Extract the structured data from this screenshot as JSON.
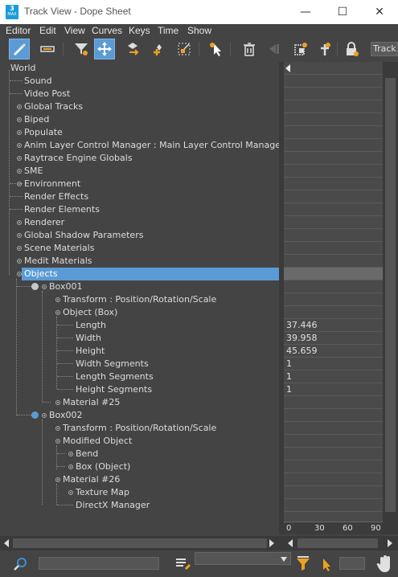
{
  "window": {
    "app_icon": {
      "top": "3",
      "bottom": "MAX"
    },
    "title": "Track View - Dope Sheet",
    "minimize": "—",
    "maximize": "☐",
    "close": "✕"
  },
  "menu": [
    "Editor",
    "Edit",
    "View",
    "Curves",
    "Keys",
    "Time",
    "Show"
  ],
  "toolbar": {
    "track_label": "Track",
    "icons": [
      "filter-icon",
      "move-keys-icon",
      "slide-keys-icon",
      "add-keys-icon",
      "scale-keys-icon",
      "select-time-icon",
      "delete-keys-icon",
      "cut-time-icon",
      "copy-time-icon",
      "paste-time-icon",
      "insert-time-icon",
      "lock-selection-icon"
    ]
  },
  "tree": {
    "root": "World",
    "items": [
      "Sound",
      "Video Post",
      "Global Tracks",
      "Biped",
      "Populate",
      "Anim Layer Control Manager : Main Layer Control Manager",
      "Raytrace Engine Globals",
      "SME",
      "Environment",
      "Render Effects",
      "Render Elements",
      "Renderer",
      "Global Shadow Parameters",
      "Scene Materials",
      "Medit Materials",
      "Objects",
      "Box001",
      "Transform : Position/Rotation/Scale",
      "Object (Box)",
      "Length",
      "Width",
      "Height",
      "Width Segments",
      "Length Segments",
      "Height Segments",
      "Material #25",
      "Box002",
      "Transform : Position/Rotation/Scale",
      "Modified Object",
      "Bend",
      "Box (Object)",
      "Material #26",
      "Texture Map",
      "DirectX Manager"
    ],
    "selected": "Objects"
  },
  "values": {
    "length": "37.446",
    "width": "39.958",
    "height": "45.659",
    "width_segments": "1",
    "length_segments": "1",
    "height_segments": "1"
  },
  "ruler_ticks": [
    "0",
    "30",
    "60",
    "90"
  ],
  "colors": {
    "selection": "#5b9bd5",
    "box001_dot": "#c8c8c8",
    "box002_dot": "#5b9bd5",
    "accent_orange": "#f0a020",
    "accent_blue": "#3b8fd6"
  }
}
